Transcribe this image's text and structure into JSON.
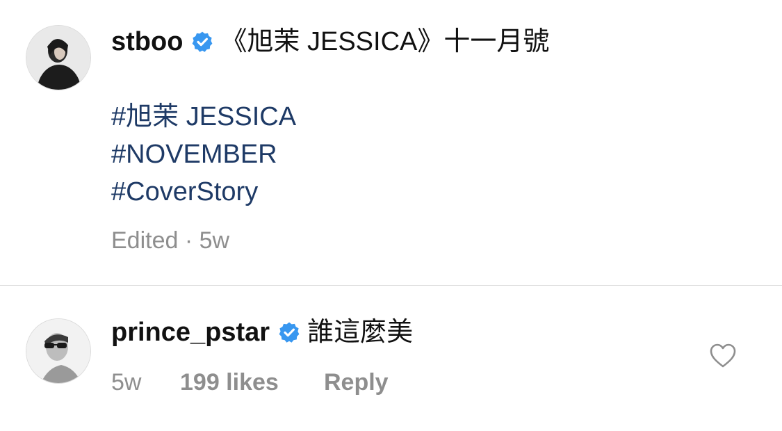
{
  "post": {
    "username": "stboo",
    "verified": true,
    "caption_title": "《旭茉 JESSICA》十一月號",
    "hashtags": [
      "#旭茉 JESSICA",
      "#NOVEMBER",
      "#CoverStory"
    ],
    "edited_label": "Edited",
    "separator": "·",
    "time_ago": "5w"
  },
  "comment": {
    "username": "prince_pstar",
    "verified": true,
    "text": "誰這麼美",
    "time_ago": "5w",
    "likes_label": "199 likes",
    "reply_label": "Reply"
  },
  "icons": {
    "verified": "verified-badge-icon",
    "like": "heart-outline-icon"
  },
  "colors": {
    "verified_badge": "#3897f0",
    "hashtag": "#1e3a66",
    "meta_text": "#8e8e8e",
    "divider": "#dbdbdb"
  }
}
